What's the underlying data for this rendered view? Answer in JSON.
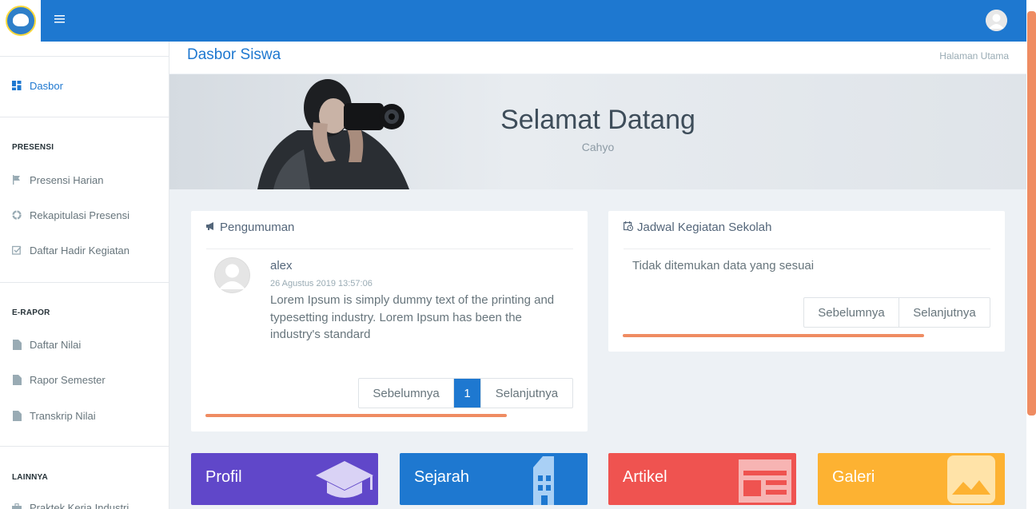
{
  "header": {
    "menu_icon": "hamburger-icon",
    "logo_icon": "school-logo",
    "user_icon": "user-avatar-icon"
  },
  "sidebar": {
    "dasbor": {
      "label": "Dasbor",
      "icon": "dashboard-icon"
    },
    "sections": [
      {
        "heading": "PRESENSI",
        "items": [
          {
            "label": "Presensi Harian",
            "icon": "flag-icon"
          },
          {
            "label": "Rekapitulasi Presensi",
            "icon": "pie-chart-icon"
          },
          {
            "label": "Daftar Hadir Kegiatan",
            "icon": "checkbox-icon"
          }
        ]
      },
      {
        "heading": "E-RAPOR",
        "items": [
          {
            "label": "Daftar Nilai",
            "icon": "file-icon"
          },
          {
            "label": "Rapor Semester",
            "icon": "file-icon"
          },
          {
            "label": "Transkrip Nilai",
            "icon": "file-icon"
          }
        ]
      },
      {
        "heading": "LAINNYA",
        "items": [
          {
            "label": "Praktek Kerja Industri",
            "icon": "briefcase-icon"
          }
        ]
      }
    ]
  },
  "page": {
    "title": "Dasbor Siswa",
    "breadcrumb": "Halaman Utama"
  },
  "banner": {
    "title": "Selamat Datang",
    "subtitle": "Cahyo"
  },
  "announcements": {
    "title": "Pengumuman",
    "icon": "megaphone-icon",
    "post": {
      "author": "alex",
      "date": "26 Agustus 2019 13:57:06",
      "body": "Lorem Ipsum is simply dummy text of the printing and typesetting industry. Lorem Ipsum has been the industry's standard"
    },
    "pager": {
      "prev": "Sebelumnya",
      "page": "1",
      "next": "Selanjutnya"
    }
  },
  "schedule": {
    "title": "Jadwal Kegiatan Sekolah",
    "icon": "calendar-clock-icon",
    "empty": "Tidak ditemukan data yang sesuai",
    "pager": {
      "prev": "Sebelumnya",
      "next": "Selanjutnya"
    }
  },
  "tiles": [
    {
      "label": "Profil",
      "color": "#6047c9",
      "icon": "graduation-cap-icon"
    },
    {
      "label": "Sejarah",
      "color": "#1e78d0",
      "icon": "building-icon"
    },
    {
      "label": "Artikel",
      "color": "#ef5350",
      "icon": "newspaper-icon"
    },
    {
      "label": "Galeri",
      "color": "#fdb232",
      "icon": "image-icon"
    }
  ],
  "colors": {
    "primary": "#1e78d0",
    "accent_orange": "#ef8c62"
  }
}
